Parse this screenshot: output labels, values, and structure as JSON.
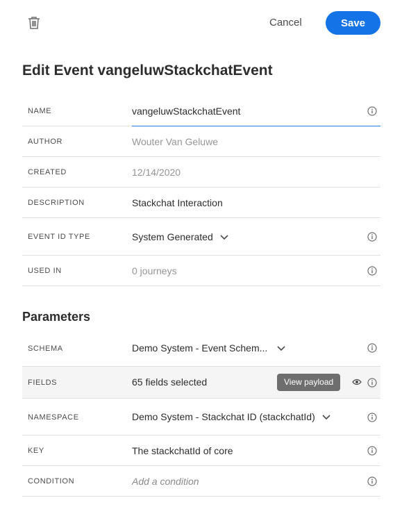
{
  "toolbar": {
    "cancel_label": "Cancel",
    "save_label": "Save",
    "accent_color": "#1473e6"
  },
  "page": {
    "title": "Edit Event vangeluwStackchatEvent"
  },
  "event_fields": [
    {
      "label": "NAME",
      "value": "vangeluwStackchatEvent"
    },
    {
      "label": "AUTHOR",
      "value": "Wouter Van Geluwe"
    },
    {
      "label": "CREATED",
      "value": "12/14/2020"
    },
    {
      "label": "DESCRIPTION",
      "value": "Stackchat Interaction"
    },
    {
      "label": "EVENT ID TYPE",
      "value": "System Generated"
    },
    {
      "label": "USED IN",
      "value": "0 journeys"
    }
  ],
  "parameters": {
    "title": "Parameters",
    "fields": [
      {
        "label": "SCHEMA",
        "value": "Demo System - Event Schem..."
      },
      {
        "label": "FIELDS",
        "value": "65 fields selected"
      },
      {
        "label": "NAMESPACE",
        "value": "Demo System - Stackchat ID (stackchatId)"
      },
      {
        "label": "KEY",
        "value": "The stackchatId of core"
      },
      {
        "label": "CONDITION",
        "value": "",
        "placeholder": "Add a condition"
      }
    ]
  },
  "tooltip": {
    "text": "View payload"
  },
  "icons": {
    "delete": "trash-icon",
    "info": "info-icon",
    "dropdown": "chevron-down-icon",
    "view": "eye-icon"
  }
}
